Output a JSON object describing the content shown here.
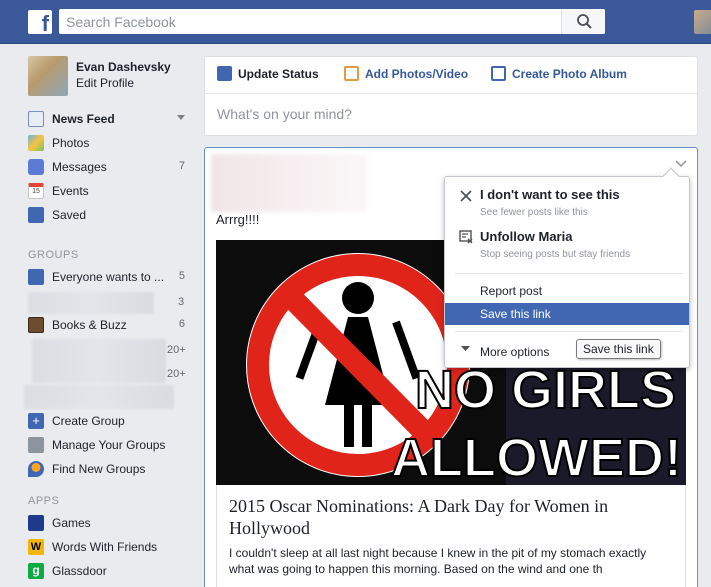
{
  "search": {
    "placeholder": "Search Facebook"
  },
  "profile": {
    "name": "Evan Dashevsky",
    "edit_label": "Edit Profile"
  },
  "nav": [
    {
      "label": "News Feed",
      "icon": "news-feed-icon"
    },
    {
      "label": "Photos",
      "icon": "photos-icon"
    },
    {
      "label": "Messages",
      "count": "7",
      "icon": "messages-icon"
    },
    {
      "label": "Events",
      "icon": "events-icon",
      "icon_text": "15"
    },
    {
      "label": "Saved",
      "icon": "saved-icon"
    }
  ],
  "groups": {
    "heading": "GROUPS",
    "items": [
      {
        "label": "Everyone wants to ...",
        "count": "5"
      },
      {
        "label": "",
        "count": "3"
      },
      {
        "label": "Books & Buzz",
        "count": "6"
      },
      {
        "label": "",
        "count": "20+"
      },
      {
        "label": "",
        "count": "20+"
      }
    ],
    "create": "Create Group",
    "manage": "Manage Your Groups",
    "find": "Find New Groups"
  },
  "apps": {
    "heading": "APPS",
    "items": [
      {
        "label": "Games",
        "icon_color": "#1e3a8a"
      },
      {
        "label": "Words With Friends",
        "icon_color": "#f2b705",
        "icon_text": "W"
      },
      {
        "label": "Glassdoor",
        "icon_color": "#0caa41",
        "icon_text": "g"
      }
    ]
  },
  "composer": {
    "tabs": [
      "Update Status",
      "Add Photos/Video",
      "Create Photo Album"
    ],
    "placeholder": "What's on your mind?"
  },
  "post": {
    "text": "Arrrg!!!!",
    "image_text_1": "NO GIRLS",
    "image_text_2": "ALLOWED!",
    "link_title": "2015 Oscar Nominations: A Dark Day for Women in Hollywood",
    "link_desc": "I couldn't sleep at all last night because I knew in the pit of my stomach exactly what was going to happen this morning. Based on the wind and one th"
  },
  "menu": {
    "hide_title": "I don't want to see this",
    "hide_sub": "See fewer posts like this",
    "unfollow_title": "Unfollow Maria",
    "unfollow_sub": "Stop seeing posts but stay friends",
    "report": "Report post",
    "save": "Save this link",
    "more": "More options",
    "tooltip": "Save this link"
  },
  "colors": {
    "brand": "#3b5998",
    "highlight": "#4267b2"
  }
}
